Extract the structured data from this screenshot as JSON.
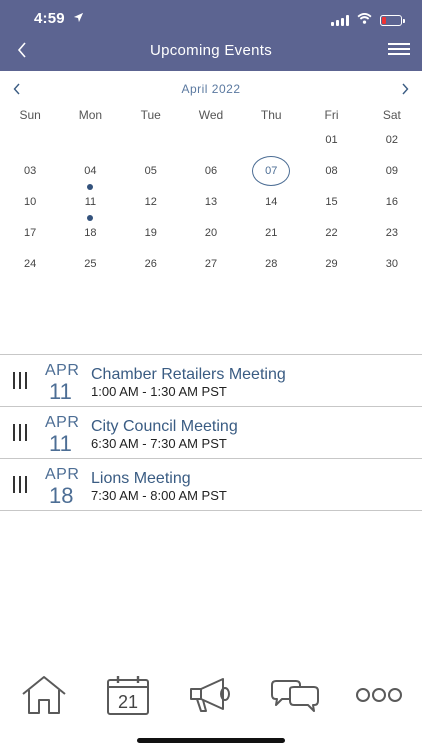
{
  "status": {
    "time": "4:59"
  },
  "header": {
    "title": "Upcoming Events"
  },
  "calendar": {
    "month_label": "April 2022",
    "weekdays": [
      "Sun",
      "Mon",
      "Tue",
      "Wed",
      "Thu",
      "Fri",
      "Sat"
    ],
    "selected_day": "07",
    "days_with_events": [
      "11",
      "18"
    ],
    "weeks": [
      [
        "",
        "",
        "",
        "",
        "",
        "01",
        "02"
      ],
      [
        "03",
        "04",
        "05",
        "06",
        "07",
        "08",
        "09"
      ],
      [
        "10",
        "11",
        "12",
        "13",
        "14",
        "15",
        "16"
      ],
      [
        "17",
        "18",
        "19",
        "20",
        "21",
        "22",
        "23"
      ],
      [
        "24",
        "25",
        "26",
        "27",
        "28",
        "29",
        "30"
      ]
    ]
  },
  "events": [
    {
      "month": "APR",
      "day": "11",
      "title": "Chamber Retailers Meeting",
      "time": "1:00 AM - 1:30 AM PST"
    },
    {
      "month": "APR",
      "day": "11",
      "title": "City Council Meeting",
      "time": "6:30 AM - 7:30 AM PST"
    },
    {
      "month": "APR",
      "day": "18",
      "title": "Lions Meeting",
      "time": "7:30 AM - 8:00 AM PST"
    }
  ],
  "tabbar": {
    "calendar_day": "21"
  },
  "colors": {
    "header_bg": "#5c6491",
    "accent": "#4d6e95",
    "event_dot": "#33527c",
    "icon_stroke": "#5a5a5a"
  }
}
